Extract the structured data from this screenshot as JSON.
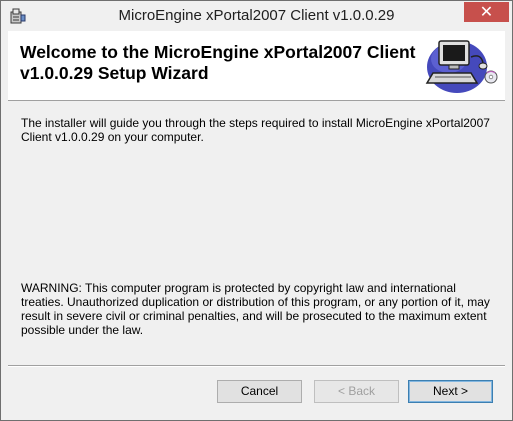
{
  "window": {
    "title": "MicroEngine xPortal2007 Client v1.0.0.29",
    "close_symbol": "✕"
  },
  "header": {
    "title_line1": "Welcome to the MicroEngine xPortal2007 Client",
    "title_line2": "v1.0.0.29 Setup Wizard",
    "icon": "computer-setup-icon"
  },
  "content": {
    "intro": "The installer will guide you through the steps required to install MicroEngine xPortal2007 Client v1.0.0.29 on your computer.",
    "warning": "WARNING: This computer program is protected by copyright law and international treaties. Unauthorized duplication or distribution of this program, or any portion of it, may result in severe civil or criminal penalties, and will be prosecuted to the maximum extent possible under the law."
  },
  "buttons": {
    "cancel": "Cancel",
    "back": "< Back",
    "next": "Next >"
  },
  "colors": {
    "close_button": "#c7504c",
    "dialog_background": "#f0f0f0",
    "header_background": "#ffffff"
  }
}
